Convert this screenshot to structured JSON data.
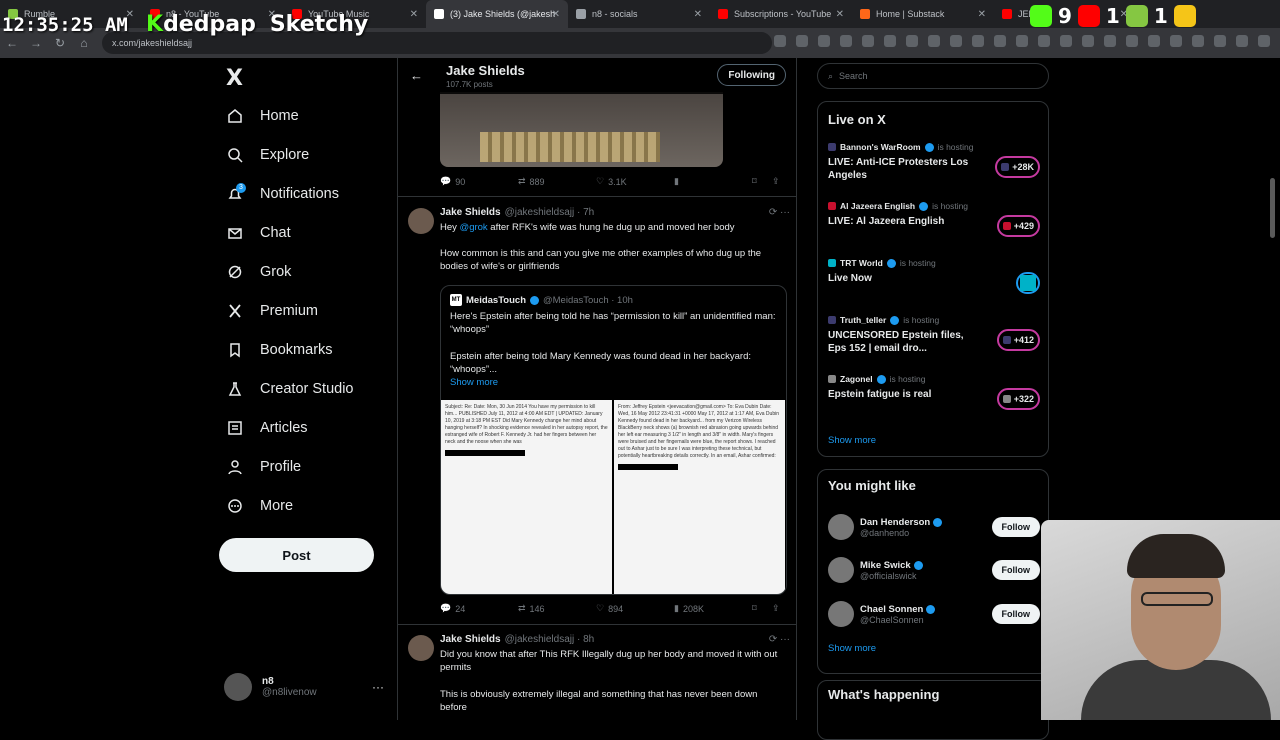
{
  "browser": {
    "tabs": [
      {
        "label": "Rumble",
        "color": "#85c742"
      },
      {
        "label": "n8 - YouTube",
        "color": "#ff0000"
      },
      {
        "label": "YouTube Music",
        "color": "#ff0000"
      },
      {
        "label": "(3) Jake Shields (@jakesh",
        "color": "#ffffff",
        "active": true
      },
      {
        "label": "n8 - socials",
        "color": "#9aa0a6"
      },
      {
        "label": "Subscriptions - YouTube",
        "color": "#ff0000"
      },
      {
        "label": "Home | Substack",
        "color": "#ff6719"
      },
      {
        "label": "JEFF",
        "color": "#ff0000"
      }
    ],
    "url": "x.com/jakeshieldsajj"
  },
  "overlay": {
    "time": "12:35:25 AM",
    "brand1": "dedpap",
    "brand2": "Sketchy",
    "counts": [
      "9",
      "1",
      "1",
      "1"
    ]
  },
  "nav": {
    "logo": "X",
    "items": [
      {
        "label": "Home",
        "icon": "home-icon"
      },
      {
        "label": "Explore",
        "icon": "search-icon"
      },
      {
        "label": "Notifications",
        "icon": "bell-icon"
      },
      {
        "label": "Chat",
        "icon": "mail-icon"
      },
      {
        "label": "Grok",
        "icon": "grok-icon"
      },
      {
        "label": "Premium",
        "icon": "x-premium-icon"
      },
      {
        "label": "Bookmarks",
        "icon": "bookmark-icon"
      },
      {
        "label": "Creator Studio",
        "icon": "flask-icon"
      },
      {
        "label": "Articles",
        "icon": "article-icon"
      },
      {
        "label": "Profile",
        "icon": "person-icon"
      },
      {
        "label": "More",
        "icon": "more-icon"
      }
    ],
    "notif_badge": "3",
    "post_label": "Post",
    "me_name": "n8",
    "me_handle": "@n8livenow",
    "me_more": "···"
  },
  "profile_header": {
    "name": "Jake Shields",
    "posts": "107.7K posts",
    "follow_label": "Following",
    "back": "←"
  },
  "tweet0": {
    "replies": "90",
    "reposts": "889",
    "likes": "3.1K"
  },
  "tweet1": {
    "name": "Jake Shields",
    "handle": "@jakeshieldsajj · 7h",
    "text_pre": "Hey ",
    "mention": "@grok",
    "text_post": " after RFK's wife was hung he dug up and moved her body",
    "text2": "How common is this and can you give me other examples of who dug up the bodies of wife's or girlfriends",
    "quote": {
      "logo": "MT",
      "name": "MeidasTouch",
      "handle": "@MeidasTouch · 10h",
      "line1": "Here's Epstein after being told he has “permission to kill” an unidentified man: “whoops”",
      "line2": "Epstein after being told Mary Kennedy was found dead in her backyard: “whoops”...",
      "show_more": "Show more",
      "doc_left": "Subject: Re:   Date: Mon, 30 Jun 2014   You have my permission to kill him...   PUBLISHED July 11, 2012 at 4:00 AM EDT | UPDATED: January 10, 2019 at 3:18 PM EST   Did Mary Kennedy change her mind about hanging herself?   In shocking evidence revealed in her autopsy report, the estranged wife of Robert F. Kennedy Jr. had her fingers between her neck and the noose when she was",
      "doc_right": "From: Jeffrey Epstein <jeevacation@gmail.com>  To: Eva Dubin  Date: Wed, 16 May 2012 23:41:31 +0000   May 17, 2012 at 1:17 AM, Eva Dubin  Kennedy found dead in her backyard...  from my Verizon Wireless BlackBerry   neck shows (a) brownish red abrasion going upwards behind her left ear measuring 3 1/2\" in length and 3/8\" in width.   Mary's fingers were bruised and her fingernails were blue, the report shows.   I reached out to Ashar just to be sure I was interpreting these technical, but potentially heartbreaking details correctly. In an email, Ashar confirmed:"
    },
    "replies": "24",
    "reposts": "146",
    "likes": "894",
    "views": "208K"
  },
  "tweet2": {
    "name": "Jake Shields",
    "handle": "@jakeshieldsajj · 8h",
    "text1": "Did you know that after This RFK Illegally dug up her body and moved it with out permits",
    "text2": "This is obviously extremely illegal and something that has never been down before"
  },
  "right": {
    "search_placeholder": "Search",
    "live_title": "Live on X",
    "live": [
      {
        "host": "Bannon's WarRoom",
        "status": "is hosting",
        "title": "LIVE: Anti-ICE Protesters Los Angeles",
        "count": "+28K",
        "flag": "#3c3b6e"
      },
      {
        "host": "Al Jazeera English",
        "status": "is hosting",
        "title": "LIVE: Al Jazeera English",
        "count": "+429",
        "flag": "#c8102e"
      },
      {
        "host": "TRT World",
        "status": "is hosting",
        "title": "Live Now",
        "count": "",
        "flag": "#00b2c8"
      },
      {
        "host": "Truth_teller",
        "status": "is hosting",
        "title": "UNCENSORED Epstein files, Eps 152 | email dro...",
        "count": "+412",
        "flag": "#3c3b6e"
      },
      {
        "host": "Zagonel",
        "status": "is hosting",
        "title": "Epstein fatigue is real",
        "count": "+322",
        "flag": "#888888"
      }
    ],
    "show_more": "Show more",
    "wtf_title": "You might like",
    "wtf": [
      {
        "name": "Dan Henderson",
        "handle": "@danhendo",
        "btn": "Follow"
      },
      {
        "name": "Mike Swick",
        "handle": "@officialswick",
        "btn": "Follow"
      },
      {
        "name": "Chael Sonnen",
        "handle": "@ChaelSonnen",
        "btn": "Follow"
      }
    ],
    "happening_title": "What's happening"
  }
}
